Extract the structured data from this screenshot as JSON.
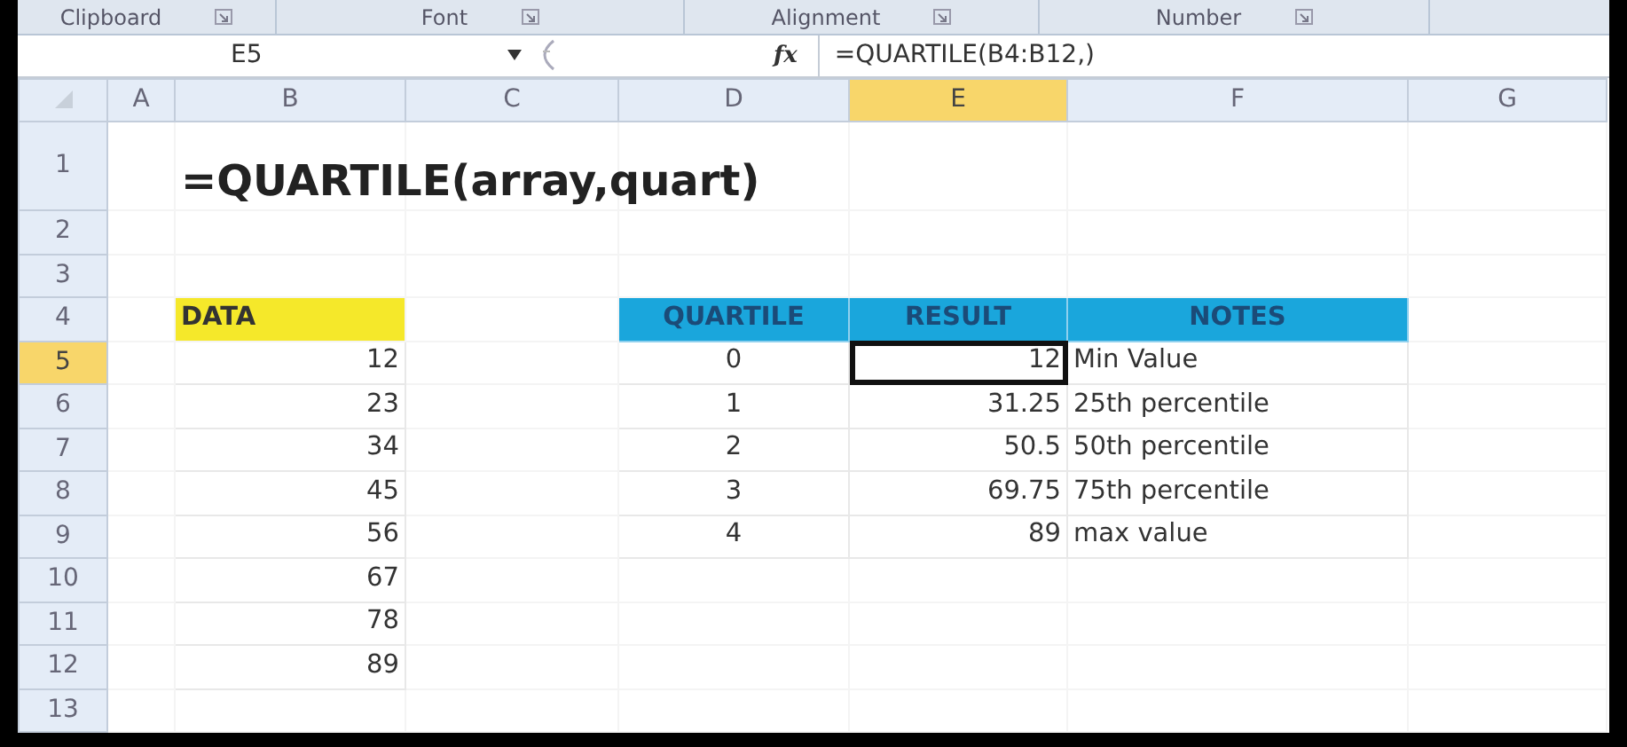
{
  "ribbon_groups": [
    {
      "label": "Clipboard"
    },
    {
      "label": "Font"
    },
    {
      "label": "Alignment"
    },
    {
      "label": "Number"
    }
  ],
  "formula_bar": {
    "name_box": "E5",
    "fx": "fx",
    "formula": "=QUARTILE(B4:B12,)"
  },
  "columns": [
    {
      "label": "A",
      "selected": false
    },
    {
      "label": "B",
      "selected": false
    },
    {
      "label": "C",
      "selected": false
    },
    {
      "label": "D",
      "selected": false
    },
    {
      "label": "E",
      "selected": true
    },
    {
      "label": "F",
      "selected": false
    },
    {
      "label": "G",
      "selected": false
    }
  ],
  "rows": [
    {
      "header": "1",
      "selected": false,
      "cells": [
        null,
        {
          "text": "=QUARTILE(array,quart)",
          "kind": "title"
        },
        null,
        null,
        null,
        null,
        null
      ]
    },
    {
      "header": "2",
      "selected": false,
      "cells": [
        null,
        null,
        null,
        null,
        null,
        null,
        null
      ]
    },
    {
      "header": "3",
      "selected": false,
      "cells": [
        null,
        null,
        null,
        null,
        null,
        null,
        null
      ]
    },
    {
      "header": "4",
      "selected": false,
      "cells": [
        null,
        {
          "text": "DATA",
          "kind": "data-header"
        },
        null,
        {
          "text": "QUARTILE",
          "kind": "table-header"
        },
        {
          "text": "RESULT",
          "kind": "table-header"
        },
        {
          "text": "NOTES",
          "kind": "table-header"
        },
        null
      ]
    },
    {
      "header": "5",
      "selected": true,
      "cells": [
        null,
        {
          "text": "12",
          "kind": "number"
        },
        null,
        {
          "text": "0",
          "kind": "centered"
        },
        {
          "text": "12",
          "kind": "number",
          "active": true
        },
        {
          "text": "Min Value",
          "kind": "note"
        },
        null
      ]
    },
    {
      "header": "6",
      "selected": false,
      "cells": [
        null,
        {
          "text": "23",
          "kind": "number"
        },
        null,
        {
          "text": "1",
          "kind": "centered"
        },
        {
          "text": "31.25",
          "kind": "number"
        },
        {
          "text": "25th percentile",
          "kind": "note"
        },
        null
      ]
    },
    {
      "header": "7",
      "selected": false,
      "cells": [
        null,
        {
          "text": "34",
          "kind": "number"
        },
        null,
        {
          "text": "2",
          "kind": "centered"
        },
        {
          "text": "50.5",
          "kind": "number"
        },
        {
          "text": "50th percentile",
          "kind": "note"
        },
        null
      ]
    },
    {
      "header": "8",
      "selected": false,
      "cells": [
        null,
        {
          "text": "45",
          "kind": "number"
        },
        null,
        {
          "text": "3",
          "kind": "centered"
        },
        {
          "text": "69.75",
          "kind": "number"
        },
        {
          "text": "75th percentile",
          "kind": "note"
        },
        null
      ]
    },
    {
      "header": "9",
      "selected": false,
      "cells": [
        null,
        {
          "text": "56",
          "kind": "number"
        },
        null,
        {
          "text": "4",
          "kind": "centered"
        },
        {
          "text": "89",
          "kind": "number"
        },
        {
          "text": "max value",
          "kind": "note"
        },
        null
      ]
    },
    {
      "header": "10",
      "selected": false,
      "cells": [
        null,
        {
          "text": "67",
          "kind": "number"
        },
        null,
        null,
        null,
        null,
        null
      ]
    },
    {
      "header": "11",
      "selected": false,
      "cells": [
        null,
        {
          "text": "78",
          "kind": "number"
        },
        null,
        null,
        null,
        null,
        null
      ]
    },
    {
      "header": "12",
      "selected": false,
      "cells": [
        null,
        {
          "text": "89",
          "kind": "number"
        },
        null,
        null,
        null,
        null,
        null
      ]
    },
    {
      "header": "13",
      "selected": false,
      "cells": [
        null,
        null,
        null,
        null,
        null,
        null,
        null
      ]
    }
  ]
}
